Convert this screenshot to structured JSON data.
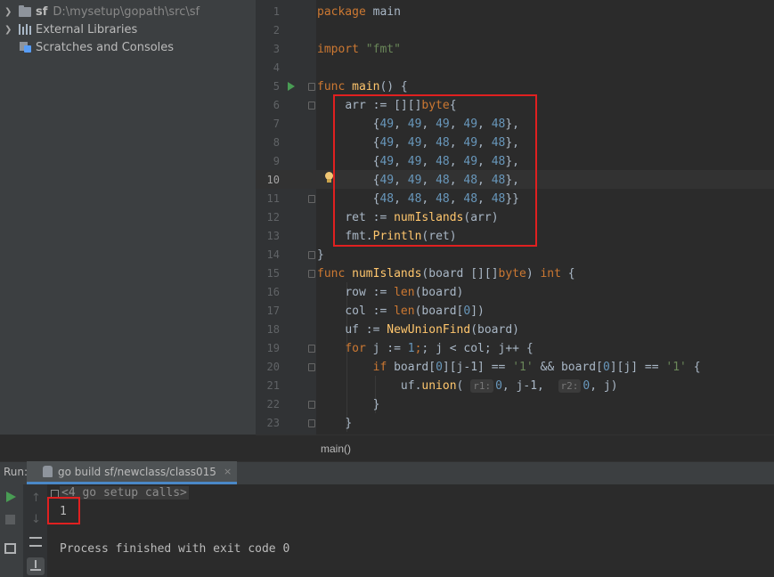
{
  "project_tree": {
    "root": {
      "name": "sf",
      "path": "D:\\mysetup\\gopath\\src\\sf"
    },
    "external_libraries": "External Libraries",
    "scratches": "Scratches and Consoles"
  },
  "editor": {
    "line_numbers": [
      "1",
      "2",
      "3",
      "4",
      "5",
      "6",
      "7",
      "8",
      "9",
      "10",
      "11",
      "12",
      "13",
      "14",
      "15",
      "16",
      "17",
      "18",
      "19",
      "20",
      "21",
      "22",
      "23"
    ],
    "current_line": "10",
    "code": {
      "l1_kw": "package",
      "l1_rest": " main",
      "l3_kw": "import",
      "l3_str": "\"fmt\"",
      "l5_kw": "func",
      "l5_fn": "main",
      "l5_rest": "() {",
      "l6_a": "arr := [][]",
      "l6_kw": "byte",
      "l6_b": "{",
      "rows": [
        [
          "49",
          "49",
          "49",
          "49",
          "48"
        ],
        [
          "49",
          "49",
          "48",
          "49",
          "48"
        ],
        [
          "49",
          "49",
          "48",
          "49",
          "48"
        ],
        [
          "49",
          "49",
          "48",
          "48",
          "48"
        ],
        [
          "48",
          "48",
          "48",
          "48",
          "48"
        ]
      ],
      "l12_a": "ret := ",
      "l12_fn": "numIslands",
      "l12_b": "(arr)",
      "l13_a": "fmt.",
      "l13_fn": "Println",
      "l13_b": "(ret)",
      "l14": "}",
      "l15_kw": "func",
      "l15_fn": "numIslands",
      "l15_a": "(board [][]",
      "l15_kw2": "byte",
      "l15_b": ") ",
      "l15_kw3": "int",
      "l15_c": " {",
      "l16_a": "row := ",
      "l16_fn": "len",
      "l16_b": "(board)",
      "l17_a": "col := ",
      "l17_fn": "len",
      "l17_b": "(board[",
      "l17_num": "0",
      "l17_c": "])",
      "l18_a": "uf := ",
      "l18_fn": "NewUnionFind",
      "l18_b": "(board)",
      "l19_kw": "for",
      "l19_a": " j := ",
      "l19_num": "1",
      "l19_b": "; j < col; j++ {",
      "l20_kw": "if",
      "l20_a": " board[",
      "l20_num1": "0",
      "l20_b": "][j-1] == ",
      "l20_str1": "'1'",
      "l20_c": " && board[",
      "l20_num2": "0",
      "l20_d": "][j] == ",
      "l20_str2": "'1'",
      "l20_e": " {",
      "l21_a": "uf.",
      "l21_fn": "union",
      "l21_b": "( ",
      "l21_hint1": "r1:",
      "l21_num1": "0",
      "l21_c": ", j-1,  ",
      "l21_hint2": "r2:",
      "l21_num2": "0",
      "l21_d": ", j)",
      "l22": "}",
      "l23": "}"
    },
    "breadcrumb": "main()"
  },
  "run_panel": {
    "label": "Run:",
    "tab_title": "go build sf/newclass/class015",
    "tab_close": "×",
    "setup_calls": "<4 go setup calls>",
    "output_value": "1",
    "exit_message": "Process finished with exit code 0"
  },
  "colors": {
    "highlight_box": "#e02020",
    "keyword": "#cc7832",
    "function": "#ffc66d",
    "string": "#6a8759",
    "number": "#6897bb"
  }
}
